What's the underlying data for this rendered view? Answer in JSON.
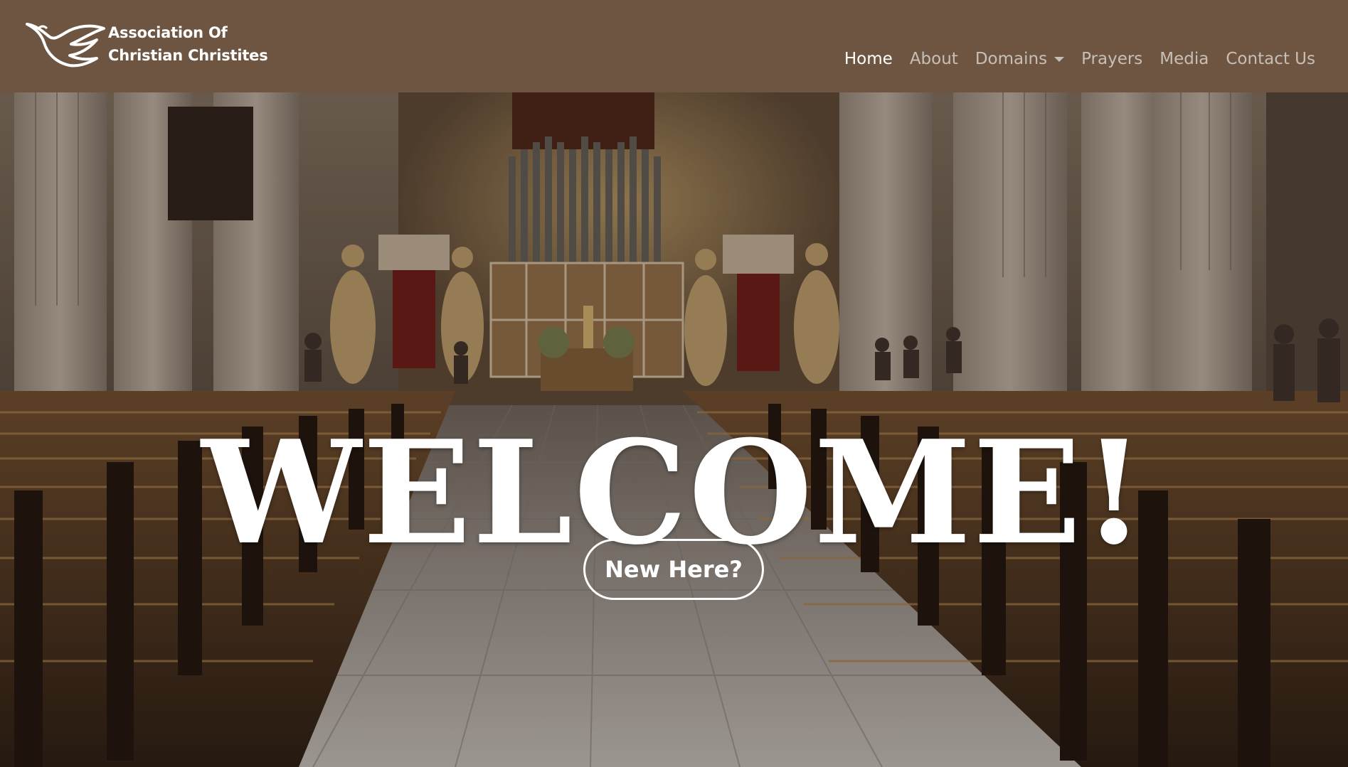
{
  "brand": {
    "line1": "Association Of",
    "line2": "Christian Christites",
    "logo_icon": "dove-icon"
  },
  "nav": {
    "items": [
      {
        "label": "Home",
        "active": true
      },
      {
        "label": "About",
        "active": false
      },
      {
        "label": "Domains",
        "active": false,
        "dropdown": true
      },
      {
        "label": "Prayers",
        "active": false
      },
      {
        "label": "Media",
        "active": false
      },
      {
        "label": "Contact Us",
        "active": false
      }
    ]
  },
  "hero": {
    "title": "WELCOME!",
    "cta_label": "New Here?",
    "background": "church-interior-image"
  },
  "colors": {
    "navbar_bg": "#6d5541",
    "nav_active": "#ffffff",
    "nav_inactive": "rgba(255,255,255,0.62)"
  }
}
